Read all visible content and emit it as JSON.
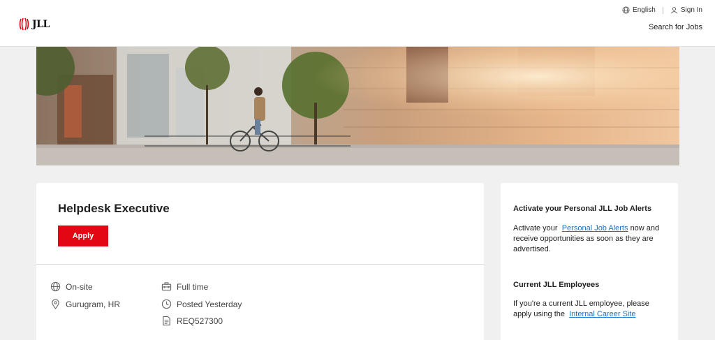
{
  "header": {
    "logo_text": "JLL",
    "language_label": "English",
    "signin_label": "Sign In",
    "search_jobs_label": "Search for Jobs"
  },
  "job": {
    "title": "Helpdesk Executive",
    "apply_label": "Apply",
    "work_mode": "On-site",
    "location": "Gurugram, HR",
    "employment_type": "Full time",
    "posted": "Posted Yesterday",
    "req_id": "REQ527300"
  },
  "sidebar": {
    "alerts_heading": "Activate your Personal JLL Job Alerts",
    "alerts_text_before": "Activate your",
    "alerts_link": "Personal Job Alerts",
    "alerts_text_after": "now and receive opportunities as soon as they are advertised.",
    "employees_heading": "Current JLL Employees",
    "employees_text": "If you're a current JLL employee, please apply using the",
    "employees_link": "Internal Career Site"
  },
  "colors": {
    "brand_red": "#e30613",
    "link_blue": "#1a73c8",
    "page_bg": "#f0f0f0"
  },
  "icons": {
    "language": "globe-icon",
    "signin": "user-icon",
    "work_mode": "globe-icon",
    "location": "map-pin-icon",
    "employment_type": "briefcase-icon",
    "posted": "clock-icon",
    "req_id": "document-icon"
  }
}
